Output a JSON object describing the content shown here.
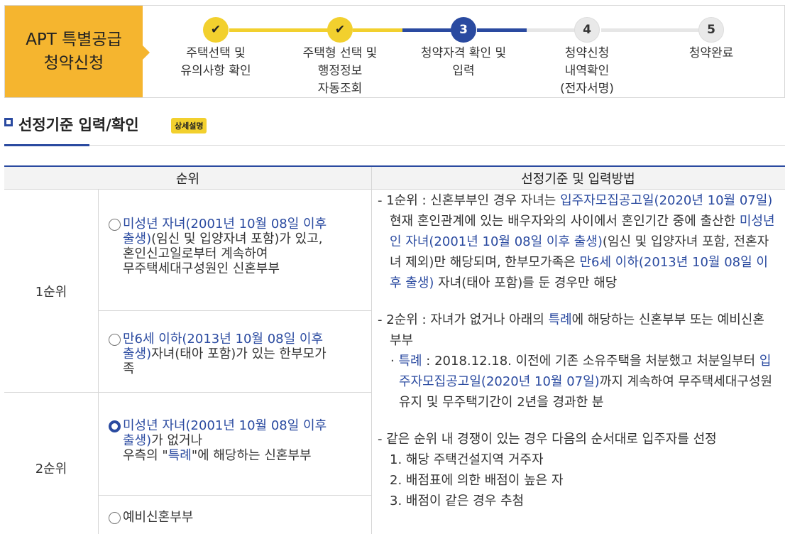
{
  "stepper": {
    "title_line1": "APT 특별공급",
    "title_line2": "청약신청",
    "steps": [
      {
        "mark": "✔",
        "label": "주택선택 및\n유의사항 확인"
      },
      {
        "mark": "✔",
        "label": "주택형 선택 및\n행정정보\n자동조회"
      },
      {
        "mark": "3",
        "label": "청약자격 확인 및\n입력"
      },
      {
        "mark": "4",
        "label": "청약신청\n내역확인\n(전자서명)"
      },
      {
        "mark": "5",
        "label": "청약완료"
      }
    ]
  },
  "section": {
    "title": "선정기준 입력/확인",
    "detail_badge": "상세설명"
  },
  "table": {
    "col_rank": "순위",
    "col_criteria": "선정기준 및 입력방법",
    "rank1_label": "1순위",
    "rank2_label": "2순위",
    "options": [
      {
        "hl": "미성년 자녀(2001년 10월 08일 이후 출생)",
        "rest": "(임신 및 입양자녀 포함)가 있고,\n혼인신고일로부터 계속하여\n무주택세대구성원인 신혼부부",
        "selected": false
      },
      {
        "hl": "만6세 이하(2013년 10월 08일 이후 출생)",
        "rest": "자녀(태아 포함)가 있는 한부모가족",
        "selected": false
      },
      {
        "hl": "미성년 자녀(2001년 10월 08일 이후 출생)",
        "rest_a": "가 없거나\n우측의 \"",
        "rest_hl": "특례",
        "rest_b": "\"에 해당하는 신혼부부",
        "selected": true
      },
      {
        "hl": "",
        "rest": "예비신혼부부",
        "selected": false
      }
    ],
    "criteria": {
      "p1_a": "- 1순위 : 신혼부부인 경우 자녀는 ",
      "p1_hl1": "입주자모집공고일(2020년 10월 07일)",
      "p1_b": " 현재 혼인관계에 있는 배우자와의 사이에서 혼인기간 중에 출산한 ",
      "p1_hl2": "미성년인 자녀(2001년 10월 08일 이후 출생)",
      "p1_c": "(임신 및 입양자녀 포함, 전혼자녀 제외)만 해당되며, 한부모가족은 ",
      "p1_hl3": "만6세 이하(2013년 10월 08일 이후 출생)",
      "p1_d": " 자녀(태아 포함)를 둔 경우만 해당",
      "p2_a": "- 2순위 : 자녀가 없거나 아래의 ",
      "p2_hl": "특례",
      "p2_b": "에 해당하는 신혼부부 또는 예비신혼부부",
      "p3_a": "· ",
      "p3_hl1": "특례",
      "p3_b": " : 2018.12.18. 이전에 기존 소유주택을 처분했고 처분일부터 ",
      "p3_hl2": "입주자모집공고일(2020년 10월 07일)",
      "p3_c": "까지 계속하여 무주택세대구성원 유지 및 무주택기간이 2년을 경과한 분",
      "p4": "- 같은 순위 내 경쟁이 있는 경우 다음의 순서대로 입주자를 선정",
      "n1": "1. 해당 주택건설지역 거주자",
      "n2": "2. 배점표에 의한 배점이 높은 자",
      "n3": "3. 배점이 같은 경우 추첨"
    }
  }
}
